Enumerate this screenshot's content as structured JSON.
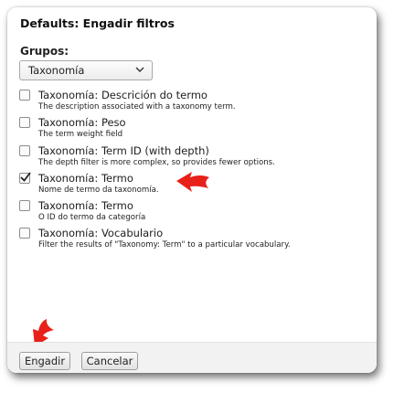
{
  "dialog": {
    "title": "Defaults: Engadir filtros",
    "group_label": "Grupos:",
    "group_select": {
      "value": "Taxonomía"
    },
    "options": [
      {
        "label": "Taxonomía: Descrición do termo",
        "description": "The description associated with a taxonomy term.",
        "checked": false
      },
      {
        "label": "Taxonomía: Peso",
        "description": "The term weight field",
        "checked": false
      },
      {
        "label": "Taxonomía: Term ID (with depth)",
        "description": "The depth filter is more complex, so provides fewer options.",
        "checked": false
      },
      {
        "label": "Taxonomía: Termo",
        "description": "Nome de termo da taxonomía.",
        "checked": true
      },
      {
        "label": "Taxonomía: Termo",
        "description": "O ID do termo da categoría",
        "checked": false
      },
      {
        "label": "Taxonomía: Vocabulario",
        "description": "Filter the results of \"Taxonomy: Term\" to a particular vocabulary.",
        "checked": false
      }
    ],
    "buttons": {
      "add": "Engadir",
      "cancel": "Cancelar"
    }
  },
  "colors": {
    "annotation_arrow": "#e8201a"
  },
  "icons": {
    "select": "chevron-down-icon",
    "checkmark": "checkmark-icon",
    "annotation": "red-arrow-icon"
  }
}
